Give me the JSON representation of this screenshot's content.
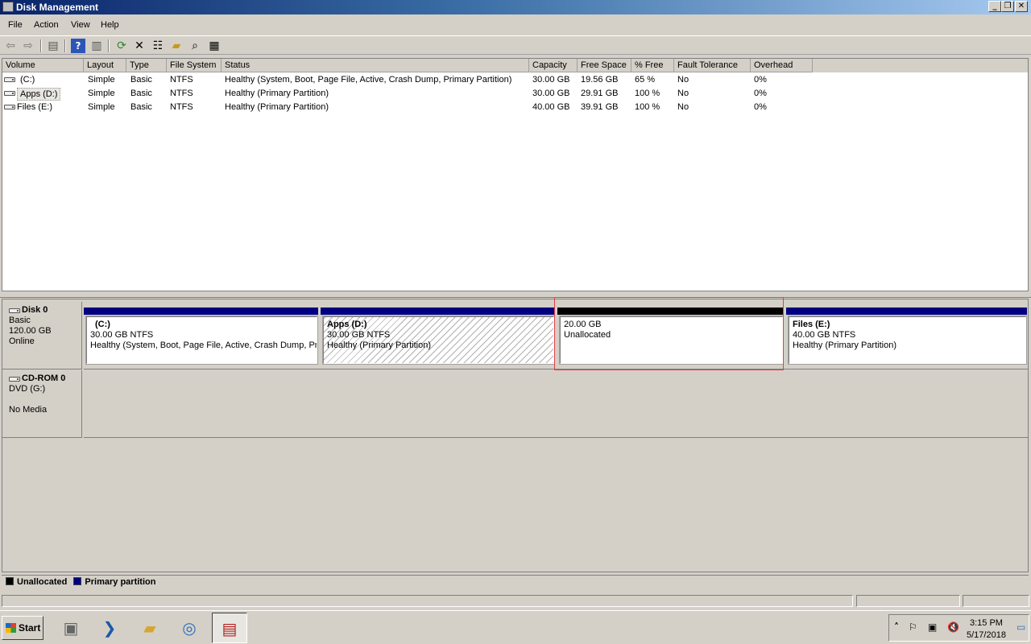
{
  "window": {
    "title": "Disk Management",
    "minimize": "_",
    "restore": "❐",
    "close": "✕"
  },
  "menu": {
    "items": [
      {
        "label": "File"
      },
      {
        "label": "Action"
      },
      {
        "label": "View"
      },
      {
        "label": "Help"
      }
    ]
  },
  "toolbar": {
    "icons": [
      "back-icon",
      "forward-icon",
      "show-hide-console-tree-icon",
      "help-icon",
      "show-hide-action-pane-icon",
      "refresh-icon",
      "delete-icon",
      "properties-icon",
      "open-icon",
      "explore-icon",
      "help-topics-icon"
    ]
  },
  "volume_list": {
    "columns": [
      "Volume",
      "Layout",
      "Type",
      "File System",
      "Status",
      "Capacity",
      "Free Space",
      "% Free",
      "Fault Tolerance",
      "Overhead"
    ],
    "rows": [
      {
        "volume": "(C:)",
        "layout": "Simple",
        "type": "Basic",
        "fs": "NTFS",
        "status": "Healthy (System, Boot, Page File, Active, Crash Dump, Primary Partition)",
        "capacity": "30.00 GB",
        "free": "19.56 GB",
        "pct": "65 %",
        "fault": "No",
        "overhead": "0%"
      },
      {
        "volume": "Apps (D:)",
        "layout": "Simple",
        "type": "Basic",
        "fs": "NTFS",
        "status": "Healthy (Primary Partition)",
        "capacity": "30.00 GB",
        "free": "29.91 GB",
        "pct": "100 %",
        "fault": "No",
        "overhead": "0%"
      },
      {
        "volume": "Files (E:)",
        "layout": "Simple",
        "type": "Basic",
        "fs": "NTFS",
        "status": "Healthy (Primary Partition)",
        "capacity": "40.00 GB",
        "free": "39.91 GB",
        "pct": "100 %",
        "fault": "No",
        "overhead": "0%"
      }
    ]
  },
  "disks": [
    {
      "name": "Disk 0",
      "type": "Basic",
      "size": "120.00 GB",
      "status": "Online"
    },
    {
      "name": "CD-ROM 0",
      "type": "DVD (G:)",
      "status": "No Media"
    }
  ],
  "partitions": [
    {
      "name": "(C:)",
      "size": "30.00 GB NTFS",
      "status": "Healthy (System, Boot, Page File, Active, Crash Dump, Pri"
    },
    {
      "name": "Apps  (D:)",
      "size": "30.00 GB NTFS",
      "status": "Healthy (Primary Partition)"
    },
    {
      "name": "",
      "size": "20.00 GB",
      "status": "Unallocated"
    },
    {
      "name": "Files  (E:)",
      "size": "40.00 GB NTFS",
      "status": "Healthy (Primary Partition)"
    }
  ],
  "legend": {
    "unallocated": "Unallocated",
    "primary": "Primary partition"
  },
  "colors": {
    "primary": "#000080",
    "unallocated": "#000000",
    "selection": "#e0404a"
  },
  "taskbar": {
    "start": "Start",
    "time": "3:15 PM",
    "date": "5/17/2018"
  }
}
